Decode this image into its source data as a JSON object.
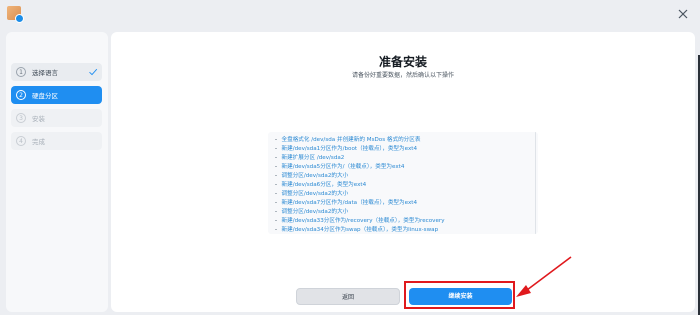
{
  "window": {
    "app_icon": "installer-app-icon",
    "close_icon": "close-icon"
  },
  "sidebar": {
    "steps": [
      {
        "number": "1",
        "label": "选择语言",
        "state": "done"
      },
      {
        "number": "2",
        "label": "硬盘分区",
        "state": "active"
      },
      {
        "number": "3",
        "label": "安装",
        "state": "pending"
      },
      {
        "number": "4",
        "label": "完成",
        "state": "pending"
      }
    ]
  },
  "main": {
    "title": "准备安装",
    "subtitle": "请备份好重要数据，然后确认以下操作",
    "operations": [
      "全盘格式化 /dev/sda 并创建新的 MsDos 格式的分区表",
      "新建/dev/sda1分区作为/boot（挂载点），类型为ext4",
      "新建扩展分区 /dev/sda2",
      "新建/dev/sda5分区作为/（挂载点），类型为ext4",
      "调整分区/dev/sda2的大小",
      "新建/dev/sda6分区，类型为ext4",
      "调整分区/dev/sda2的大小",
      "新建/dev/sda7分区作为/data（挂载点），类型为ext4",
      "调整分区/dev/sda2的大小",
      "新建/dev/sda33分区作为/recovery（挂载点），类型为recovery",
      "新建/dev/sda34分区作为swap（挂载点），类型为linux-swap"
    ]
  },
  "buttons": {
    "back": "返回",
    "continue": "继续安装"
  },
  "annotation": {
    "color": "#e0191d"
  },
  "colors": {
    "accent": "#1f8ef1",
    "operation_text": "#2a89d3"
  }
}
